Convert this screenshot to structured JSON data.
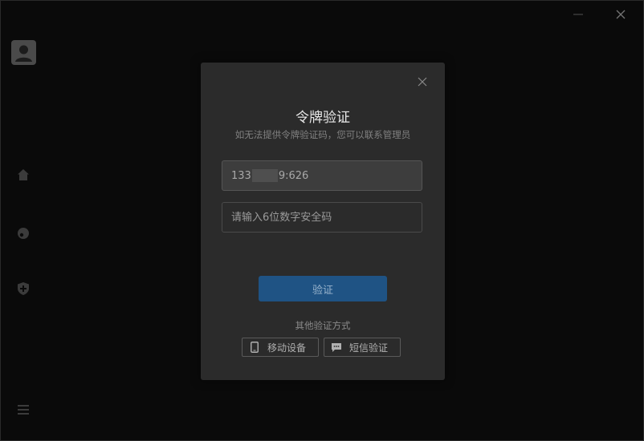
{
  "window": {
    "minimize_icon": "minimize-icon",
    "close_icon": "close-icon"
  },
  "sidebar": {
    "avatar_icon": "user-avatar-icon",
    "items": [
      {
        "icon": "home-icon"
      },
      {
        "icon": "disc-icon"
      },
      {
        "icon": "shield-plus-icon"
      }
    ],
    "menu_icon": "hamburger-menu-icon"
  },
  "dialog": {
    "title": "令牌验证",
    "subtitle": "如无法提供令牌验证码，您可以联系管理员",
    "phone_prefix": "133",
    "phone_suffix": "9:626",
    "code_placeholder": "请输入6位数字安全码",
    "verify_label": "验证",
    "other_methods_label": "其他验证方式",
    "device_label": "移动设备",
    "sms_label": "短信验证"
  },
  "colors": {
    "accent": "#1f5384",
    "dialog_bg": "#2b2b2b",
    "app_bg": "#0e0e0e"
  }
}
